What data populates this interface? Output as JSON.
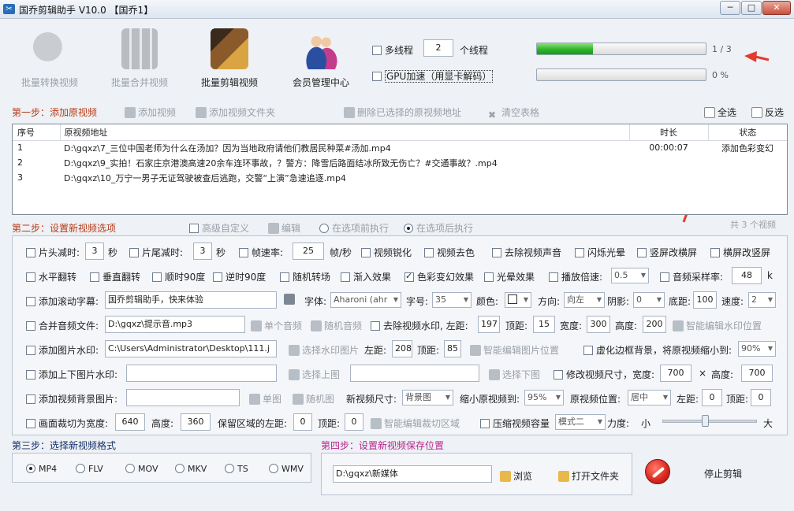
{
  "window": {
    "title": "国乔剪辑助手 V10.0  【国乔1】",
    "icon": "scissors-icon"
  },
  "toolbar": [
    {
      "label": "批量转换视频",
      "icon": "convert-icon",
      "enabled": false
    },
    {
      "label": "批量合并视频",
      "icon": "merge-icon",
      "enabled": false
    },
    {
      "label": "批量剪辑视频",
      "icon": "film-edit-icon",
      "enabled": true
    },
    {
      "label": "会员管理中心",
      "icon": "users-icon",
      "enabled": true
    }
  ],
  "threads": {
    "multithread_label": "多线程",
    "count": "2",
    "count_unit": "个线程",
    "gpu_label": "GPU加速（用显卡解码）"
  },
  "progress": {
    "main_text": "1 / 3",
    "main_fraction": 0.333,
    "sub_text": "0 %",
    "sub_fraction": 0
  },
  "step1": {
    "title": "第一步：添加原视频",
    "add_video": "添加视频",
    "add_folder": "添加视频文件夹",
    "delete_selected": "删除已选择的原视频地址",
    "clear_table": "清空表格",
    "select_all": "全选",
    "invert": "反选"
  },
  "table": {
    "headers": [
      "序号",
      "原视频地址",
      "时长",
      "状态"
    ],
    "rows": [
      [
        "1",
        "D:\\gqxz\\7_三位中国老师为什么在汤加？因为当地政府请他们教居民种菜#汤加.mp4",
        "00:00:07",
        "添加色彩变幻"
      ],
      [
        "2",
        "D:\\gqxz\\9_实拍！石家庄京港澳高速20余车连环事故，？警方：降雪后路面结冰所致无伤亡？#交通事故？.mp4",
        "",
        ""
      ],
      [
        "3",
        "D:\\gqxz\\10_万宁一男子无证驾驶被查后逃跑，交警“上演”急速追逐.mp4",
        "",
        ""
      ]
    ],
    "total_text": "共 3 个视频"
  },
  "step2": {
    "title": "第二步：设置新视频选项",
    "advanced": "高级自定义",
    "edit": "编辑",
    "before": "在选项前执行",
    "after": "在选项后执行"
  },
  "opts": {
    "r1": {
      "head_cut": "片头减时:",
      "head_val": "3",
      "sec1": "秒",
      "tail_cut": "片尾减时:",
      "tail_val": "3",
      "sec2": "秒",
      "fps": "帧速率:",
      "fps_val": "25",
      "fps_unit": "帧/秒",
      "sharpen": "视频锐化",
      "decolor": "视频去色",
      "mute": "去除视频声音",
      "flash": "闪烁光晕",
      "v2h": "竖屏改横屏",
      "h2v": "横屏改竖屏"
    },
    "r2": {
      "hflip": "水平翻转",
      "vflip": "垂直翻转",
      "cw90": "顺时90度",
      "ccw90": "逆时90度",
      "random_trans": "随机转场",
      "fade_in": "渐入效果",
      "color_shift": "色彩变幻效果",
      "glow": "光晕效果",
      "speed": "播放倍速:",
      "speed_val": "0.5",
      "sample": "音频采样率:",
      "sample_val": "48",
      "sample_unit": "k"
    },
    "r3": {
      "scroll": "添加滚动字幕:",
      "scroll_text": "国乔剪辑助手，快来体验",
      "font": "字体:",
      "font_val": "Aharoni (ahr",
      "size": "字号:",
      "size_val": "35",
      "color": "颜色:",
      "dir": "方向:",
      "dir_val": "向左",
      "shadow": "阴影:",
      "shadow_val": "0",
      "bottom": "底距:",
      "bottom_val": "100",
      "speed": "速度:",
      "speed_val": "2"
    },
    "r4": {
      "merge_audio": "合并音频文件:",
      "audio_path": "D:\\gqxz\\提示音.mp3",
      "single": "单个音频",
      "random": "随机音频",
      "rm_wm": "去除视频水印, 左距:",
      "left": "197",
      "top_l": "顶距:",
      "top": "15",
      "w_l": "宽度:",
      "w": "300",
      "h_l": "高度:",
      "h": "200",
      "smart": "智能编辑水印位置"
    },
    "r5": {
      "img_wm": "添加图片水印:",
      "img_path": "C:\\Users\\Administrator\\Desktop\\111.j",
      "choose": "选择水印图片",
      "left_l": "左距:",
      "left": "208",
      "top_l": "顶距:",
      "top": "85",
      "smart": "智能编辑图片位置",
      "blur": "虚化边框背景，将原视频缩小到:",
      "blur_val": "90%"
    },
    "r6": {
      "updown": "添加上下图片水印:",
      "up_btn": "选择上图",
      "down_btn": "选择下图",
      "resize": "修改视频尺寸，宽度:",
      "w": "700",
      "x": "×",
      "h_l": "高度:",
      "h": "700"
    },
    "r7": {
      "bg": "添加视频背景图片:",
      "single": "单图",
      "random": "随机图",
      "size_l": "新视频尺寸:",
      "size_val": "背景图",
      "shrink_l": "缩小原视频到:",
      "shrink_val": "95%",
      "pos_l": "原视频位置:",
      "pos_val": "居中",
      "left_l": "左距:",
      "left": "0",
      "top_l": "顶距:",
      "top": "0"
    },
    "r8": {
      "crop": "画面裁切为宽度:",
      "w": "640",
      "h_l": "高度:",
      "h": "360",
      "keep_l": "保留区域的左距:",
      "left": "0",
      "top_l": "顶距:",
      "top": "0",
      "smart": "智能编辑裁切区域",
      "compress": "压缩视频容量",
      "mode": "模式二",
      "force": "力度:",
      "small": "小",
      "big": "大"
    }
  },
  "step3": {
    "title": "第三步：选择新视频格式",
    "formats": [
      "MP4",
      "FLV",
      "MOV",
      "MKV",
      "TS",
      "WMV"
    ]
  },
  "step4": {
    "title": "第四步：设置新视频保存位置",
    "path": "D:\\gqxz\\新媒体",
    "browse": "浏览",
    "open_folder": "打开文件夹"
  },
  "stop": {
    "label": "停止剪辑"
  },
  "colors": {
    "accent_red": "#e23b2e",
    "progress_green": "#2fb52a",
    "step_orange": "#b83c16",
    "step_blue": "#14306b",
    "step_magenta": "#b8248e"
  }
}
